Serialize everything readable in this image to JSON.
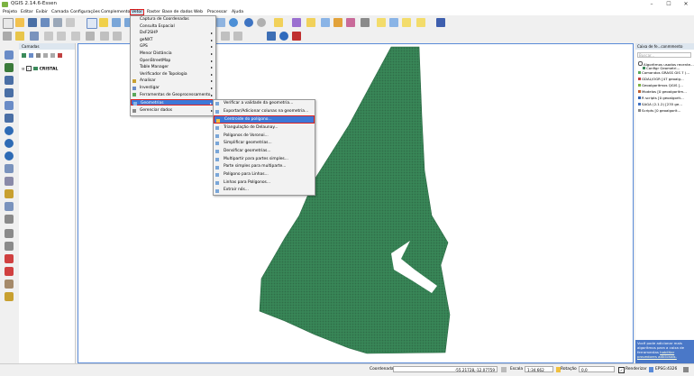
{
  "window": {
    "title": "QGIS 2.14.6-Essen",
    "controls": [
      "–",
      "☐",
      "✕"
    ]
  },
  "menubar": {
    "items": [
      "Projeto",
      "Editar",
      "Exibir",
      "Camada",
      "Configurações",
      "Complementos",
      "Vetor",
      "Raster",
      "Base de dados",
      "Web",
      "Processar",
      "Ajuda"
    ]
  },
  "vector_menu": {
    "items": [
      {
        "label": "Captura de Coordenadas",
        "submenu": false
      },
      {
        "label": "Consulta Espacial",
        "submenu": false
      },
      {
        "label": "DxF2SHP",
        "submenu": true
      },
      {
        "label": "geNXT",
        "submenu": true
      },
      {
        "label": "GPS",
        "submenu": true
      },
      {
        "label": "Menor Distância",
        "submenu": true
      },
      {
        "label": "OpenStreetMap",
        "submenu": true
      },
      {
        "label": "Table Manager",
        "submenu": true
      },
      {
        "label": "Verificador de Topologia",
        "submenu": true
      },
      {
        "label": "Analisar",
        "submenu": true
      },
      {
        "label": "Investigar",
        "submenu": true
      },
      {
        "label": "Ferramentas de Geoprocessamento",
        "submenu": true
      },
      {
        "label": "Geometrias",
        "submenu": true
      },
      {
        "label": "Gerenciar dados",
        "submenu": true
      }
    ]
  },
  "geometry_submenu": {
    "items": [
      "Verificar a validade da geometria...",
      "Exportar/Adicionar colunas na geometria...",
      "Centroide do polígono...",
      "Triangulação de Delaunay...",
      "Polígonos de Voronoi...",
      "Simplificar geometrias...",
      "Densificar geometrias...",
      "Multipartir para partes simples...",
      "Parte simples para multiparte...",
      "Polígono para Linhas...",
      "Linhas para Polígonos...",
      "Extrair nós..."
    ]
  },
  "layers_panel": {
    "title": "Camadas",
    "layer": "CRISTAL"
  },
  "toolbox_panel": {
    "title": "Caixa de fe...conmmento",
    "search_placeholder": "Buscar...",
    "items": [
      "Algoritmos usados recente...",
      "Configr Geometri...",
      "Comandos GRASS GIS 7 (...",
      "GDAL/OGR [47 geoalg...",
      "Geoalgoritmos QGIS [...",
      "Modelos [0 geoalgoritm...",
      "R scripts [0 geoalgorit...",
      "SAGA (2.1.2) [235 ge...",
      "Scripts [0 geoalgorit..."
    ],
    "note_text": "Você pode adicionar mais algoritmos para a caixa de ferramentas",
    "note_link": "habilitar provedores adicionais."
  },
  "statusbar": {
    "coord_label": "Coordenada",
    "coord_value": "-55.21728,-12.07759",
    "scale_label": "Escala",
    "scale_value": "1:34.662",
    "rotation_label": "Rotação",
    "rotation_value": "0,0",
    "render_label": "Renderizar",
    "crs": "EPSG:4326"
  },
  "colors": {
    "accent": "#3c78d8",
    "highlight_red": "#e02020",
    "polygon_fill": "#3a8a5a"
  }
}
